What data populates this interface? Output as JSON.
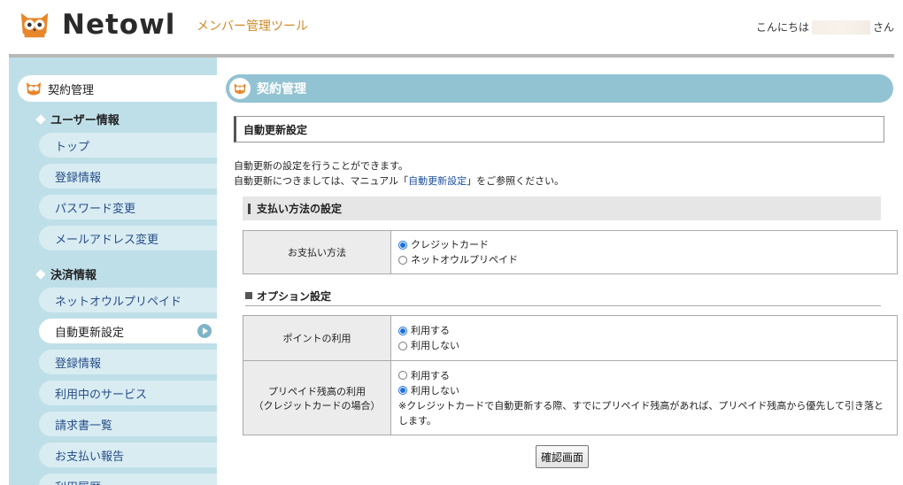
{
  "header": {
    "logo_text": "Netowl",
    "tool_title": "メンバー管理ツール",
    "greeting_prefix": "こんにちは",
    "greeting_suffix": "さん"
  },
  "sidebar": {
    "head_label": "契約管理",
    "sections": [
      {
        "title": "ユーザー情報",
        "items": [
          "トップ",
          "登録情報",
          "パスワード変更",
          "メールアドレス変更"
        ]
      },
      {
        "title": "決済情報",
        "items": [
          "ネットオウルプリペイド",
          "自動更新設定",
          "登録情報",
          "利用中のサービス",
          "請求書一覧",
          "お支払い報告",
          "利用履歴"
        ]
      }
    ],
    "active_item": "自動更新設定"
  },
  "main": {
    "heading": "契約管理",
    "box_title": "自動更新設定",
    "desc_line1": "自動更新の設定を行うことができます。",
    "desc_line2_prefix": "自動更新につきましては、マニュアル「",
    "desc_link": "自動更新設定",
    "desc_line2_suffix": "」をご参照ください。",
    "payment_section": "支払い方法の設定",
    "payment_label": "お支払い方法",
    "payment_options": [
      "クレジットカード",
      "ネットオウルプリペイド"
    ],
    "payment_selected": "クレジットカード",
    "option_section": "オプション設定",
    "points_label": "ポイントの利用",
    "points_options": [
      "利用する",
      "利用しない"
    ],
    "points_selected": "利用する",
    "prepaid_label_line1": "プリペイド残高の利用",
    "prepaid_label_line2": "（クレジットカードの場合）",
    "prepaid_options": [
      "利用する",
      "利用しない"
    ],
    "prepaid_selected": "利用しない",
    "prepaid_note": "※クレジットカードで自動更新する際、すでにプリペイド残高があれば、プリペイド残高から優先して引き落とします。",
    "confirm_button": "確認画面"
  },
  "colors": {
    "sidebar_bg": "#bfdfe8",
    "heading_bg": "#92c3d2",
    "brand_orange": "#d08a2a",
    "link": "#1b4fa0"
  }
}
